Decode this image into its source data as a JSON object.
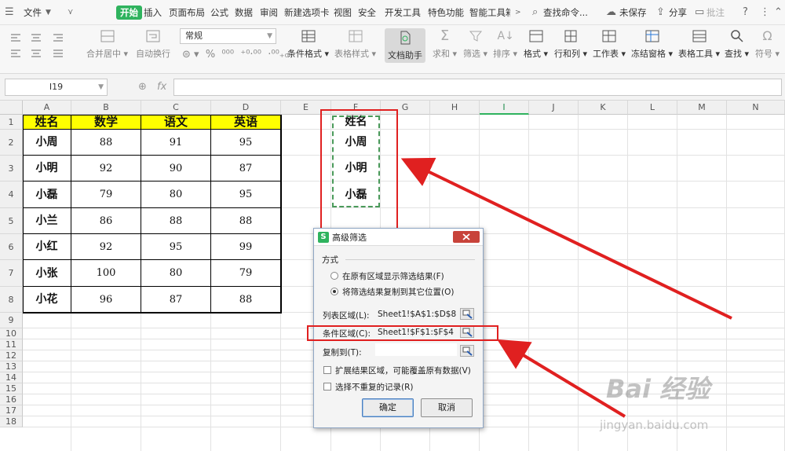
{
  "menu": {
    "file": "文件",
    "tabs": [
      "开始",
      "插入",
      "页面布局",
      "公式",
      "数据",
      "审阅",
      "新建选项卡",
      "视图",
      "安全",
      "开发工具",
      "特色功能",
      "智能工具箱"
    ],
    "search": "查找命令...",
    "unsaved": "未保存",
    "share": "分享",
    "comment": "批注"
  },
  "ribbon": {
    "merge": "合并居中",
    "wrap": "自动换行",
    "number_format": "常规",
    "cond_format": "条件格式",
    "table_style": "表格样式",
    "doc_helper": "文档助手",
    "sum": "求和",
    "filter": "筛选",
    "sort": "排序",
    "format": "格式",
    "rowcol": "行和列",
    "sheet": "工作表",
    "freeze": "冻结窗格",
    "table_tools": "表格工具",
    "find": "查找",
    "symbol": "符号"
  },
  "formula_bar": {
    "name_box": "I19",
    "fx": "fx",
    "formula": ""
  },
  "grid": {
    "columns": [
      "A",
      "B",
      "C",
      "D",
      "E",
      "F",
      "G",
      "H",
      "I",
      "J",
      "K",
      "L",
      "M",
      "N"
    ],
    "selected_column": "I",
    "rows": [
      "1",
      "2",
      "3",
      "4",
      "5",
      "6",
      "7",
      "8",
      "9",
      "10",
      "11",
      "12",
      "13",
      "14",
      "15",
      "16",
      "17",
      "18"
    ]
  },
  "table": {
    "headers": [
      "姓名",
      "数学",
      "语文",
      "英语"
    ],
    "rows": [
      [
        "小周",
        "88",
        "91",
        "95"
      ],
      [
        "小明",
        "92",
        "90",
        "87"
      ],
      [
        "小磊",
        "79",
        "80",
        "95"
      ],
      [
        "小兰",
        "86",
        "88",
        "88"
      ],
      [
        "小红",
        "92",
        "95",
        "99"
      ],
      [
        "小张",
        "100",
        "80",
        "79"
      ],
      [
        "小花",
        "96",
        "87",
        "88"
      ]
    ]
  },
  "criteria": [
    "姓名",
    "小周",
    "小明",
    "小磊"
  ],
  "dialog": {
    "title": "高级筛选",
    "section": "方式",
    "option1": "在原有区域显示筛选结果(F)",
    "option2": "将筛选结果复制到其它位置(O)",
    "list_label": "列表区域(L):",
    "list_value": "Sheet1!$A$1:$D$8",
    "criteria_label": "条件区域(C):",
    "criteria_value": "Sheet1!$F$1:$F$4",
    "copy_label": "复制到(T):",
    "copy_value": "",
    "expand": "扩展结果区域，可能覆盖原有数据(V)",
    "unique": "选择不重复的记录(R)",
    "ok": "确定",
    "cancel": "取消"
  },
  "watermark": {
    "brand": "Bai 经验",
    "url": "jingyan.baidu.com"
  },
  "colors": {
    "accent": "#2fb35e",
    "header_fill": "#ffff00",
    "annotation": "#e02020"
  }
}
